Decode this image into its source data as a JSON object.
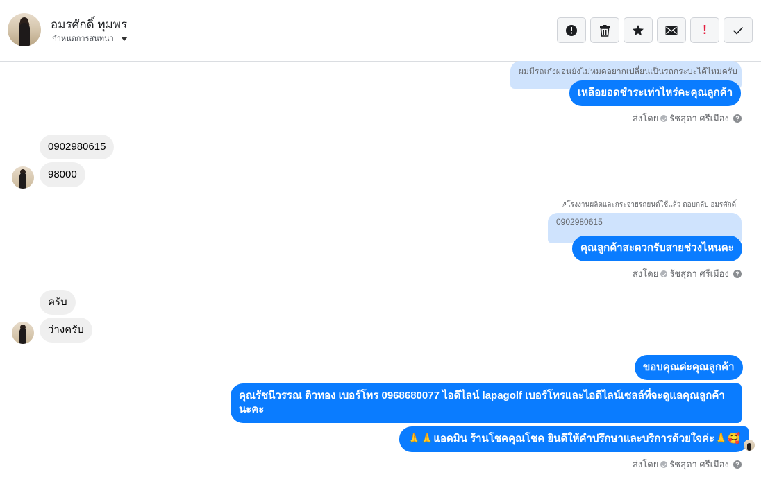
{
  "header": {
    "contact_name": "อมรศักดิ์ ทุมพร",
    "assign_label": "กำหนดการสนทนา"
  },
  "toolbar": {
    "buttons": [
      {
        "icon": "alert-circle-icon"
      },
      {
        "icon": "trash-icon"
      },
      {
        "icon": "star-icon"
      },
      {
        "icon": "envelope-icon"
      },
      {
        "icon": "exclamation-icon",
        "glyph": "!"
      },
      {
        "icon": "check-icon"
      }
    ],
    "exclamation_color": "#e41e3f"
  },
  "messages": {
    "m1_reply_preview": "ผมมีรถเก๋งผ่อนยังไม่หมดอยากเปลี่ยนเป็นรถกระบะได้ไหมครับ",
    "m1_text": "เหลือยอดชำระเท่าไหร่คะคุณลูกค้า",
    "sent1": {
      "prefix": "ส่งโดย",
      "name": "รัชสุดา ศรีเมือง"
    },
    "in1": "0902980615",
    "in2": "98000",
    "reply_note": "โรงงานผลิตและกระจายรถยนต์ใช้แล้ว ตอบกลับ อมรศักดิ์",
    "m2_reply_preview": "0902980615",
    "m2_text": "คุณลูกค้าสะดวกรับสายช่วงไหนคะ",
    "sent2": {
      "prefix": "ส่งโดย",
      "name": "รัชสุดา ศรีเมือง"
    },
    "in3": "ครับ",
    "in4": "ว่างครับ",
    "out3": "ขอบคุณค่ะคุณลูกค้า",
    "out4": "คุณรัชนีวรรณ ติวทอง     เบอร์โทร 0968680077  ไอดีไลน์ lapagolf   เบอร์โทรและไอดีไลน์เซลล์ที่จะดูแลคุณลูกค้านะคะ",
    "out5": "🙏🙏แอดมิน ร้านโชคคุณโชค ยินดีให้คำปรึกษาและบริการด้วยใจค่ะ🙏🥰",
    "sent3": {
      "prefix": "ส่งโดย",
      "name": "รัชสุดา ศรีเมือง"
    }
  },
  "colors": {
    "outgoing": "#0a7cff",
    "incoming": "#efefef",
    "reply_preview": "#cfe3fd"
  }
}
